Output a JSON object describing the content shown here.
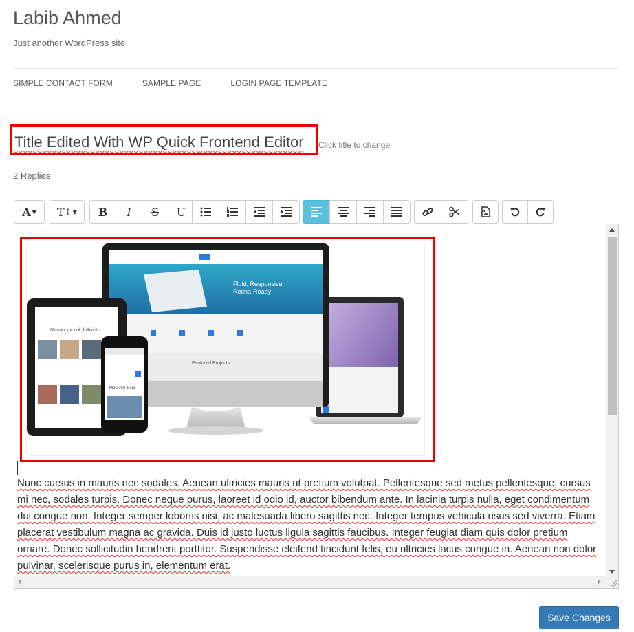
{
  "site": {
    "title": "Labib Ahmed",
    "description": "Just another WordPress site"
  },
  "nav": {
    "items": [
      {
        "label": "SIMPLE CONTACT FORM"
      },
      {
        "label": "SAMPLE PAGE"
      },
      {
        "label": "LOGIN PAGE TEMPLATE"
      }
    ]
  },
  "post": {
    "title_part1": "Title Edited With WP Quick ",
    "title_part2": "Frontend",
    "title_part3": " Editor",
    "click_hint": "Click title to change",
    "replies": "2 Replies"
  },
  "toolbar": {
    "font_size_label": "A",
    "format_label": "T",
    "bold_label": "B",
    "italic_label": "I",
    "strike_label": "S",
    "underline_label": "U",
    "active_alignment": "align-left"
  },
  "editor": {
    "body": "Nunc cursus in mauris nec sodales. Aenean ultricies mauris ut pretium volutpat. Pellentesque sed metus pellentesque, cursus mi nec, sodales turpis. Donec neque purus, laoreet id odio id, auctor bibendum ante. In lacinia turpis nulla, eget condimentum dui congue non. Integer semper lobortis nisi, ac malesuada libero sagittis nec. Integer tempus vehicula risus sed viverra. Etiam placerat vestibulum magna ac gravida. Duis id justo luctus ligula sagittis faucibus. Integer feugiat diam quis dolor pretium ornare. Donec sollicitudin hendrerit porttitor. Suspendisse eleifend tincidunt felis, eu ultricies lacus congue in. Aenean non dolor pulvinar, scelerisque purus in, elementum erat."
  },
  "image_mock": {
    "monitor_text_1": "Fluid, Responsive",
    "monitor_text_2": "Retina-Ready",
    "monitor_section": "Featured Projects",
    "tablet_text": "Masonry 4 col. fullwidth",
    "phone_text": "Masonry 4 col."
  },
  "actions": {
    "save_label": "Save Changes"
  },
  "colors": {
    "accent": "#337ab7",
    "active_tool": "#5bc0de",
    "highlight_border": "#ee0000"
  }
}
